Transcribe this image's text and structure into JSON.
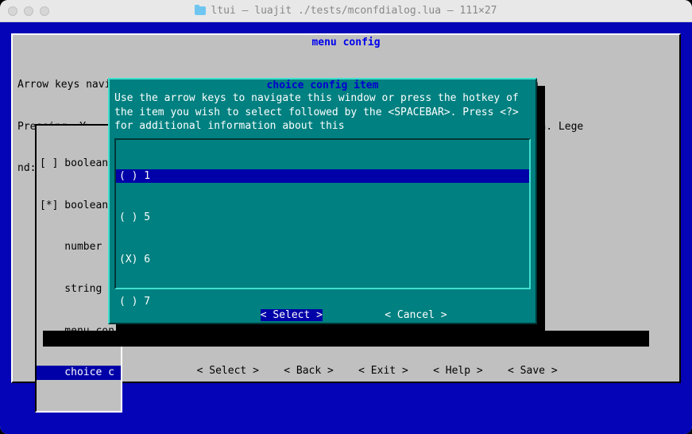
{
  "window": {
    "title_prefix": "ltui",
    "title_sep": " — ",
    "title_cmd": "luajit ./tests/mconfdialog.lua — 111×27"
  },
  "menu": {
    "title": "menu config",
    "legend_l1": "Arrow keys navigate the menu. <Enter> selects submenus ---> (or empty submenus ----).",
    "legend_l2_left": "Pressing <Y>",
    "legend_l2_right": "Search. Lege",
    "legend_l3_left": "nd: [*] built",
    "items": [
      {
        "label": "[ ] boolean "
      },
      {
        "label": "[*] boolean "
      },
      {
        "label": "    number c"
      },
      {
        "label": "    string c"
      },
      {
        "label": "    menu con"
      },
      {
        "label": "    choice c"
      }
    ],
    "selected_index": 5,
    "buttons": {
      "select": "< Select >",
      "back": "< Back >",
      "exit": "< Exit >",
      "help": "< Help >",
      "save": "< Save >"
    }
  },
  "choice": {
    "title": "choice config item",
    "help": "Use the arrow keys to navigate this window or press the hotkey of the item you wish to select followed by the <SPACEBAR>. Press <?> for additional information about this",
    "items": [
      {
        "label": "( ) 1"
      },
      {
        "label": "( ) 5"
      },
      {
        "label": "(X) 6"
      },
      {
        "label": "( ) 7"
      }
    ],
    "selected_index": 0,
    "buttons": {
      "select": "< Select >",
      "cancel": "< Cancel >"
    }
  },
  "colors": {
    "blue_bg": "#0504b6",
    "gray_bg": "#c0c0c0",
    "cyan_bg": "#008080",
    "sel_bg": "#0000a8"
  }
}
